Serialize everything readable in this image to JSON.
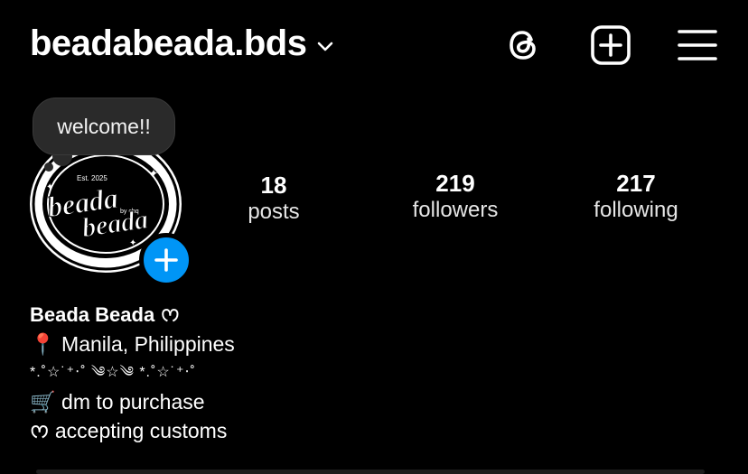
{
  "header": {
    "username": "beadabeada.bds",
    "icons": [
      "chevron-down-icon",
      "threads-icon",
      "new-post-icon",
      "menu-icon"
    ]
  },
  "profile": {
    "note_text": "welcome!!",
    "avatar_text": {
      "top": "Est. 2025",
      "main": "beada",
      "sub": "by chq",
      "second": "beada"
    },
    "stats": {
      "posts_count": "18",
      "posts_label": "posts",
      "followers_count": "219",
      "followers_label": "followers",
      "following_count": "217",
      "following_label": "following"
    }
  },
  "bio": {
    "display_name": "Beada Beada",
    "heart_glyph": "ᰔ",
    "location_icon": "📍",
    "location": "Manila, Philippines",
    "decoration": "*.˚☆˙⁺‧˚ ༄☆༄ *.˚☆˙⁺‧˚",
    "cart_icon": "🛒",
    "purchase": "dm to purchase",
    "customs_icon": "ᰔ",
    "customs": "accepting customs"
  }
}
